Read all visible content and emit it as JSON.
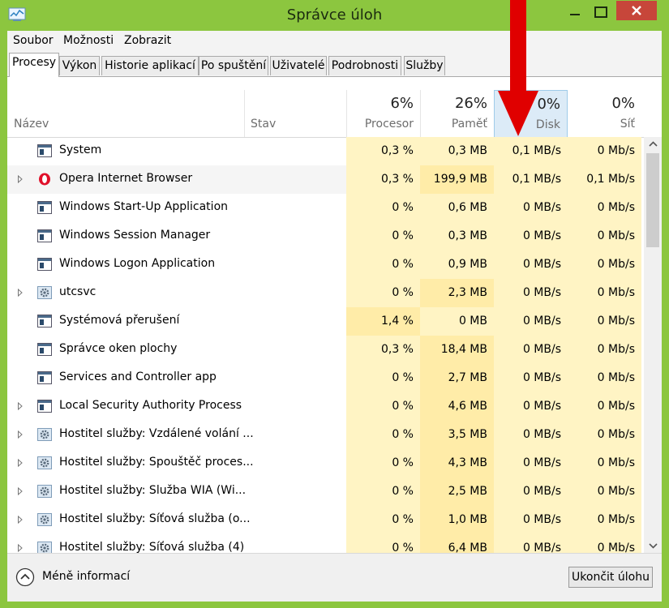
{
  "window": {
    "title": "Správce úloh"
  },
  "menu": [
    "Soubor",
    "Možnosti",
    "Zobrazit"
  ],
  "tabs": [
    "Procesy",
    "Výkon",
    "Historie aplikací",
    "Po spuštění",
    "Uživatelé",
    "Podrobnosti",
    "Služby"
  ],
  "columns": {
    "name": "Název",
    "status": "Stav",
    "cpu": {
      "pct": "6%",
      "label": "Procesor"
    },
    "mem": {
      "pct": "26%",
      "label": "Paměť"
    },
    "disk": {
      "pct": "0%",
      "label": "Disk"
    },
    "net": {
      "pct": "0%",
      "label": "Síť"
    }
  },
  "rows": [
    {
      "name": "System",
      "cpu": "0,3 %",
      "mem": "0,3 MB",
      "disk": "0,1 MB/s",
      "net": "0 Mb/s",
      "icon": "app-window-icon",
      "expand": false
    },
    {
      "name": "Opera Internet Browser",
      "cpu": "0,3 %",
      "mem": "199,9 MB",
      "disk": "0,1 MB/s",
      "net": "0,1 Mb/s",
      "icon": "opera-icon",
      "expand": true
    },
    {
      "name": "Windows Start-Up Application",
      "cpu": "0 %",
      "mem": "0,6 MB",
      "disk": "0 MB/s",
      "net": "0 Mb/s",
      "icon": "app-window-icon",
      "expand": false
    },
    {
      "name": "Windows Session Manager",
      "cpu": "0 %",
      "mem": "0,3 MB",
      "disk": "0 MB/s",
      "net": "0 Mb/s",
      "icon": "app-window-icon",
      "expand": false
    },
    {
      "name": "Windows Logon Application",
      "cpu": "0 %",
      "mem": "0,9 MB",
      "disk": "0 MB/s",
      "net": "0 Mb/s",
      "icon": "app-window-icon",
      "expand": false
    },
    {
      "name": "utcsvc",
      "cpu": "0 %",
      "mem": "2,3 MB",
      "disk": "0 MB/s",
      "net": "0 Mb/s",
      "icon": "gear-icon",
      "expand": true
    },
    {
      "name": "Systémová přerušení",
      "cpu": "1,4 %",
      "mem": "0 MB",
      "disk": "0 MB/s",
      "net": "0 Mb/s",
      "icon": "app-window-icon",
      "expand": false
    },
    {
      "name": "Správce oken plochy",
      "cpu": "0,3 %",
      "mem": "18,4 MB",
      "disk": "0 MB/s",
      "net": "0 Mb/s",
      "icon": "app-window-icon",
      "expand": false
    },
    {
      "name": "Services and Controller app",
      "cpu": "0 %",
      "mem": "2,7 MB",
      "disk": "0 MB/s",
      "net": "0 Mb/s",
      "icon": "app-window-icon",
      "expand": false
    },
    {
      "name": "Local Security Authority Process",
      "cpu": "0 %",
      "mem": "4,6 MB",
      "disk": "0 MB/s",
      "net": "0 Mb/s",
      "icon": "app-window-icon",
      "expand": true
    },
    {
      "name": "Hostitel služby: Vzdálené volání ...",
      "cpu": "0 %",
      "mem": "3,5 MB",
      "disk": "0 MB/s",
      "net": "0 Mb/s",
      "icon": "gear-icon",
      "expand": true
    },
    {
      "name": "Hostitel služby: Spouštěč proces...",
      "cpu": "0 %",
      "mem": "4,3 MB",
      "disk": "0 MB/s",
      "net": "0 Mb/s",
      "icon": "gear-icon",
      "expand": true
    },
    {
      "name": "Hostitel služby: Služba WIA (Wi...",
      "cpu": "0 %",
      "mem": "2,5 MB",
      "disk": "0 MB/s",
      "net": "0 Mb/s",
      "icon": "gear-icon",
      "expand": true
    },
    {
      "name": "Hostitel služby: Síťová služba (o...",
      "cpu": "0 %",
      "mem": "1,0 MB",
      "disk": "0 MB/s",
      "net": "0 Mb/s",
      "icon": "gear-icon",
      "expand": true
    },
    {
      "name": "Hostitel služby: Síťová služba (4)",
      "cpu": "0 %",
      "mem": "6,4 MB",
      "disk": "0 MB/s",
      "net": "0 Mb/s",
      "icon": "gear-icon",
      "expand": true
    }
  ],
  "footer": {
    "less_label": "Méně informací",
    "end_task": "Ukončit úlohu"
  },
  "colors": {
    "frame": "#8cc63f",
    "close": "#c7463a",
    "heat_low": "#fff4c4",
    "heat_mid": "#ffeca8",
    "disk_header": "#dcebf7",
    "arrow": "#e00000"
  }
}
